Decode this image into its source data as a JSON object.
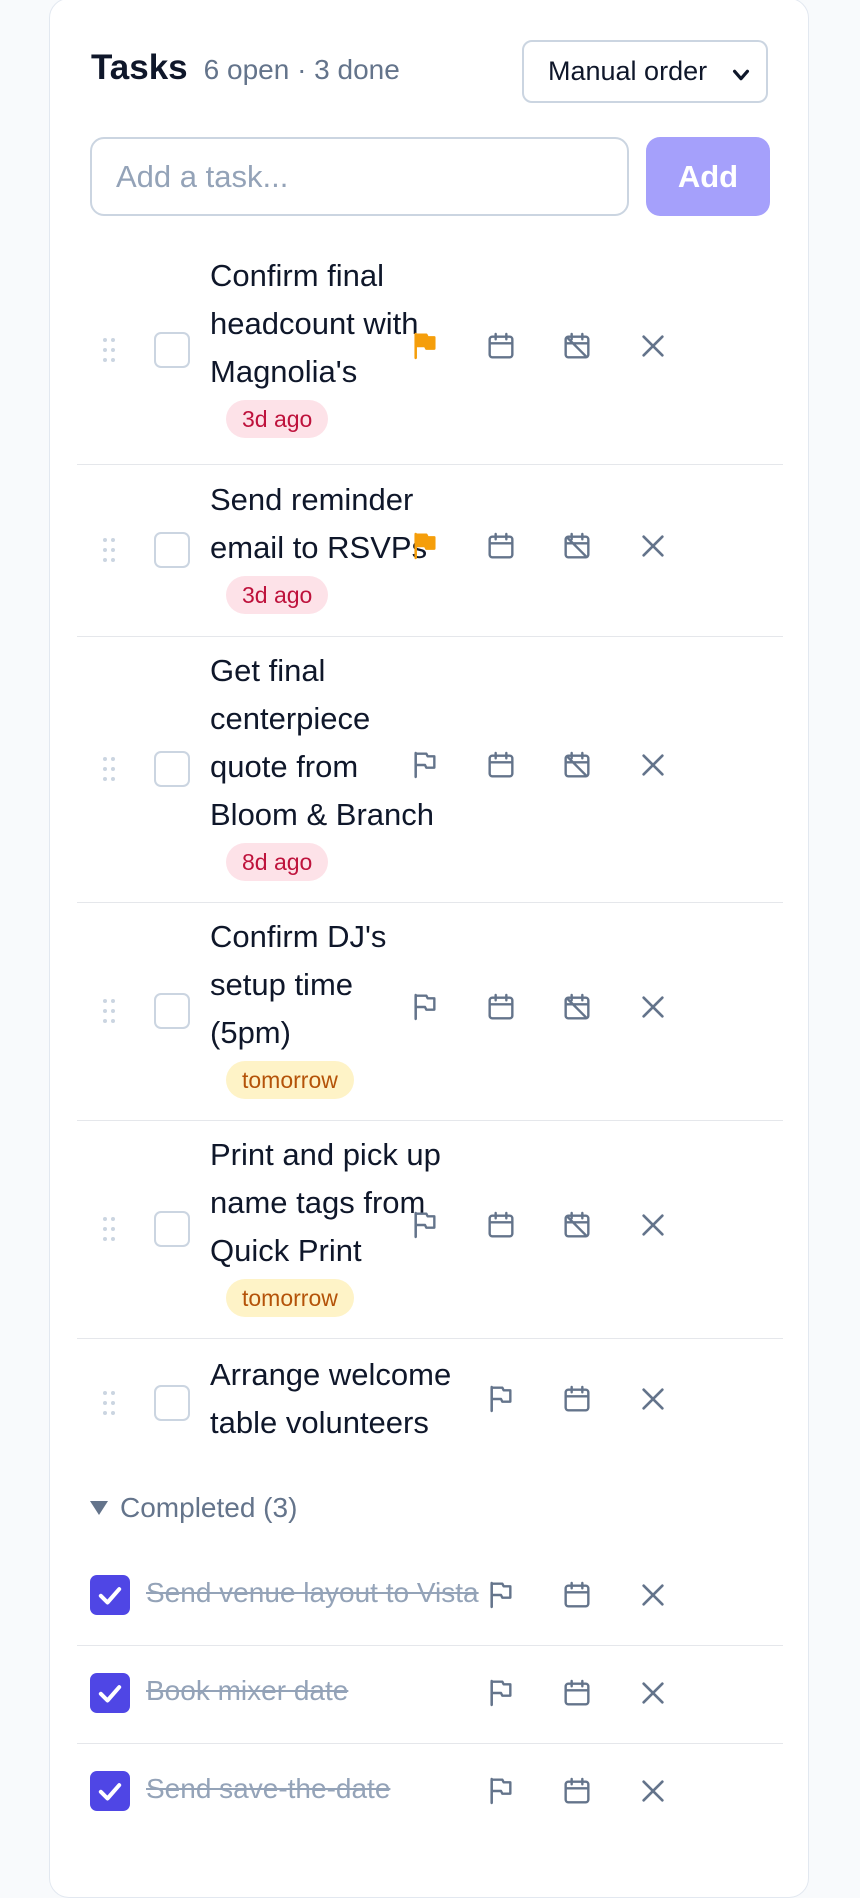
{
  "header": {
    "title": "Tasks",
    "summary": "6 open · 3 done"
  },
  "sort": {
    "selected": "Manual order"
  },
  "add": {
    "placeholder": "Add a task...",
    "button_label": "Add"
  },
  "colors": {
    "accent": "#4f46e5",
    "accent_disabled": "#a5a0fb",
    "flag_active": "#f59e0b",
    "overdue": "#be123c",
    "due_soon": "#b45309"
  },
  "tasks": [
    {
      "lines": [
        "Confirm final",
        "headcount with",
        "Magnolia's"
      ],
      "due": "3d ago",
      "due_status": "overdue",
      "flagged": true,
      "has_due": true
    },
    {
      "lines": [
        "Send reminder",
        "email to RSVPs"
      ],
      "due": "3d ago",
      "due_status": "overdue",
      "flagged": true,
      "has_due": true
    },
    {
      "lines": [
        "Get final",
        "centerpiece",
        "quote from",
        "Bloom & Branch"
      ],
      "due": "8d ago",
      "due_status": "overdue",
      "flagged": false,
      "has_due": true
    },
    {
      "lines": [
        "Confirm DJ's",
        "setup time",
        "(5pm)"
      ],
      "due": "tomorrow",
      "due_status": "soon",
      "flagged": false,
      "has_due": true
    },
    {
      "lines": [
        "Print and pick up",
        "name tags from",
        "Quick Print"
      ],
      "due": "tomorrow",
      "due_status": "soon",
      "flagged": false,
      "has_due": true
    },
    {
      "lines": [
        "Arrange welcome",
        "table volunteers"
      ],
      "due": "",
      "due_status": "none",
      "flagged": false,
      "has_due": false
    }
  ],
  "completed": {
    "label": "Completed (3)",
    "items": [
      {
        "text": "Send venue layout to Vista"
      },
      {
        "text": "Book mixer date"
      },
      {
        "text": "Send save-the-date"
      }
    ]
  },
  "icons": {
    "drag": "drag-handle-icon",
    "flag": "flag-icon",
    "calendar": "calendar-icon",
    "clear_date": "calendar-clear-icon",
    "delete": "close-icon",
    "check": "check-icon",
    "toggle": "triangle-down-icon",
    "select": "chevron-down-icon"
  }
}
